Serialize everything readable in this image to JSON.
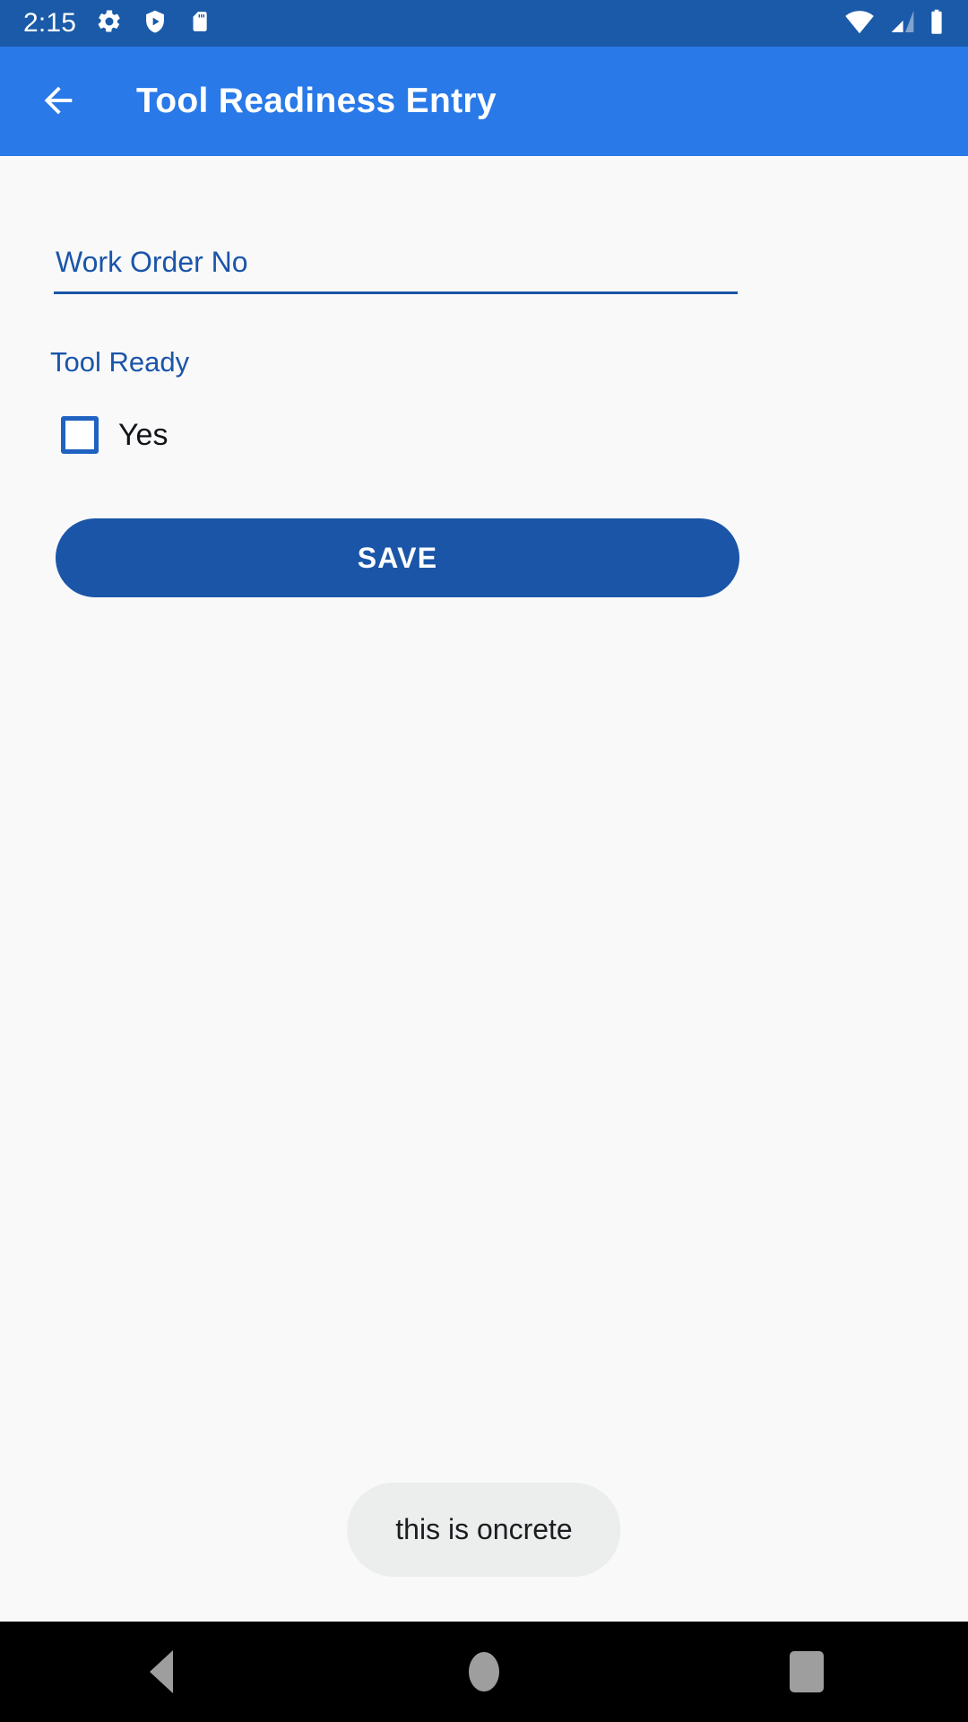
{
  "status_bar": {
    "clock": "2:15",
    "left_icons": [
      "settings-gear-icon",
      "play-protect-shield-icon",
      "sd-card-icon"
    ],
    "right_icons": [
      "wifi-icon",
      "cellular-signal-icon",
      "battery-full-icon"
    ],
    "background_color": "#1a5aa8"
  },
  "app_bar": {
    "title": "Tool Readiness Entry",
    "back_icon": "arrow-back-icon",
    "background_color": "#2979e8",
    "text_color": "#ffffff"
  },
  "form": {
    "work_order": {
      "placeholder": "Work Order No",
      "value": "",
      "accent_color": "#1a55a8"
    },
    "tool_ready": {
      "label": "Tool Ready",
      "checkbox_label": "Yes",
      "checked": false,
      "checkbox_border_color": "#1f62c0"
    },
    "save_label": "SAVE",
    "save_color": "#1a55a8"
  },
  "toast": {
    "message": "this is oncrete",
    "background_color": "#eceded",
    "text_color": "#1c1d20"
  },
  "nav_bar": {
    "back_icon": "nav-back-triangle-icon",
    "home_icon": "nav-home-circle-icon",
    "recents_icon": "nav-recents-square-icon",
    "background_color": "#000000"
  },
  "page": {
    "background_color": "#f9f9fa"
  }
}
